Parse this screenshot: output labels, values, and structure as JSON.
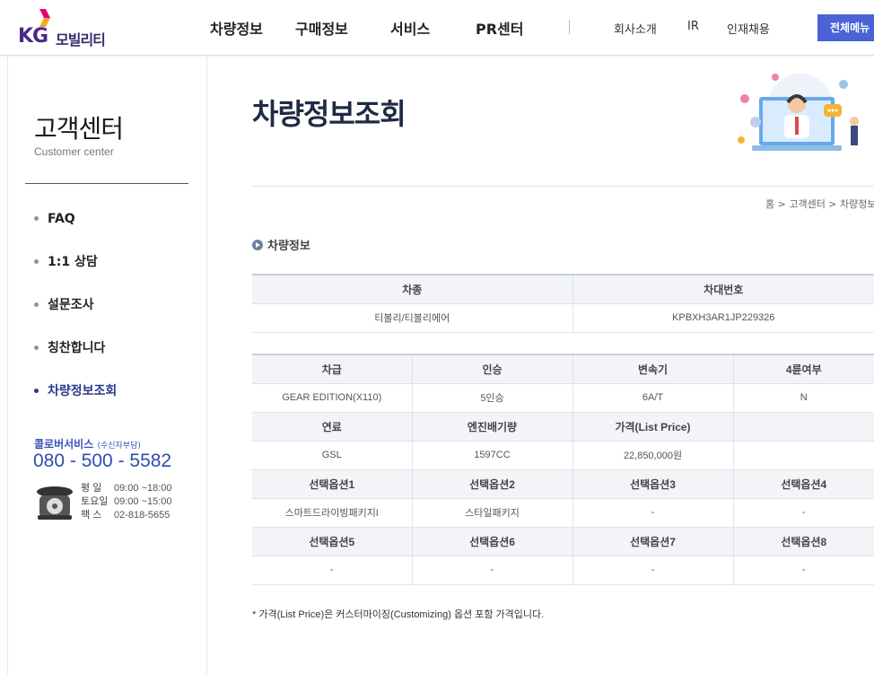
{
  "header": {
    "logo_kg": "KG",
    "logo_text": "모빌리티",
    "nav": [
      "차량정보",
      "구매정보",
      "서비스",
      "PR센터"
    ],
    "util": [
      "회사소개",
      "IR",
      "인재채용"
    ],
    "all_menu": "전체메뉴"
  },
  "sidebar": {
    "title": "고객센터",
    "subtitle": "Customer center",
    "items": [
      {
        "label": "FAQ"
      },
      {
        "label": "1:1 상담"
      },
      {
        "label": "설문조사"
      },
      {
        "label": "칭찬합니다"
      },
      {
        "label": "차량정보조회"
      }
    ],
    "call_center": {
      "label": "콜로버서비스",
      "label_note": "(수신자부담)",
      "phone": "080 - 500 - 5582",
      "hours": [
        {
          "key": "평  일",
          "value": "09:00 ~18:00"
        },
        {
          "key": "토요일",
          "value": "09:00 ~15:00"
        },
        {
          "key": "팩  스",
          "value": "02-818-5655"
        }
      ]
    }
  },
  "main": {
    "title": "차량정보조회",
    "breadcrumb": "홈 > 고객센터 > 차량정보",
    "section_title": "차량정보",
    "table1": {
      "headers": [
        "차종",
        "차대번호"
      ],
      "row": [
        "티볼리/티볼리에어",
        "KPBXH3AR1JP229326"
      ]
    },
    "table2": {
      "rows": [
        {
          "headers": [
            "차급",
            "인승",
            "변속기",
            "4륜여부"
          ],
          "values": [
            "GEAR EDITION(X110)",
            "5인승",
            "6A/T",
            "N"
          ]
        },
        {
          "headers": [
            "연료",
            "엔진배기량",
            "가격(List Price)",
            ""
          ],
          "values": [
            "GSL",
            "1597CC",
            "22,850,000원",
            ""
          ]
        },
        {
          "headers": [
            "선택옵션1",
            "선택옵션2",
            "선택옵션3",
            "선택옵션4"
          ],
          "values": [
            "스마트드라이빙패키지I",
            "스타일패키지",
            "-",
            "-"
          ]
        },
        {
          "headers": [
            "선택옵션5",
            "선택옵션6",
            "선택옵션7",
            "선택옵션8"
          ],
          "values": [
            "-",
            "-",
            "-",
            "-"
          ]
        }
      ]
    },
    "note": "* 가격(List Price)은 커스터마이징(Customizing) 옵션 포함 가격입니다."
  },
  "colors": {
    "brand_purple": "#4a2a86",
    "accent_blue": "#4b63d6",
    "phone_blue": "#2e4bb0",
    "active_menu": "#2b3a8c"
  }
}
